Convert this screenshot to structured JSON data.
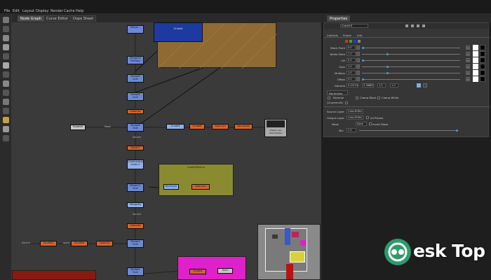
{
  "menu": [
    "File",
    "Edit",
    "Layout",
    "Display",
    "Render",
    "Cache",
    "Help"
  ],
  "graph_tabs": [
    "Node Graph",
    "Curve Editor",
    "Dope Sheet"
  ],
  "props_tab": "Properties",
  "props_header": {
    "node_name": "Grade16"
  },
  "props_subtabs": [
    "Controls",
    "Frame",
    "Info"
  ],
  "params": [
    {
      "label": "Black Point",
      "value": "0.0"
    },
    {
      "label": "White Point",
      "value": "1.0"
    },
    {
      "label": "Lift",
      "value": "0.0"
    },
    {
      "label": "Gain",
      "value": "1.0"
    },
    {
      "label": "Multiply",
      "value": "1.0"
    },
    {
      "label": "Offset",
      "value": "0.0"
    }
  ],
  "gamma": {
    "label": "Gamma",
    "values": [
      "0.40724",
      "0.38883",
      "1.0",
      "1.0"
    ]
  },
  "normalize_tab": "Normalize",
  "reverse_label": "Reverse",
  "clamp_black": "Clamp Black",
  "clamp_white": "Clamp White",
  "unpremult_label": "(Unpremult)",
  "source_layer": {
    "label": "Source Layer",
    "value": "Color.RGBA"
  },
  "output_layer": {
    "label": "Output Layer",
    "value": "Color.RGBA",
    "extra": "All Planes"
  },
  "mask": {
    "label": "Mask",
    "value": "None",
    "invert": "Invert Mask"
  },
  "mix": {
    "label": "Mix",
    "value": "1.0"
  },
  "nodes": {
    "top1": "Merge...",
    "grade_box": "Grade8",
    "merge1": "Merge10\nMultiply",
    "merge2": "Merge6\nOver",
    "orange1": "ColorCor",
    "readleft": "Rotate6",
    "merge3": "Merge8\nOver",
    "grade_blue": "Grade4",
    "orange2": "Grade6",
    "orange3": "ColorCorr",
    "orange4": "Saturation",
    "viewer": "Viewer_key\n(Pull Grade)",
    "orange5": "Keyer1",
    "blue5": "ColorLookup\nshots 2",
    "backdrop2": "Grade/Mixture",
    "blue6": "Blurkeyer",
    "orange6": "ColorCorr",
    "merge4": "Merge11\nOver",
    "blue7": "Merge5b",
    "orange7": "Saturate",
    "src": "Source",
    "orange8": "Shuffle3",
    "orange9": "Shuffle4",
    "orange10": "ColorCor",
    "merge5": "Merge4\nOver",
    "merge6": "Merge2\nOver",
    "pink": "Grade4",
    "gray2": "Dot1"
  },
  "labels": {
    "arrow1": "Mask",
    "arrow2": "Source",
    "arrow3": "Source",
    "arrow4": "Source",
    "arrow5": "apply"
  },
  "watermark": "esk Top"
}
